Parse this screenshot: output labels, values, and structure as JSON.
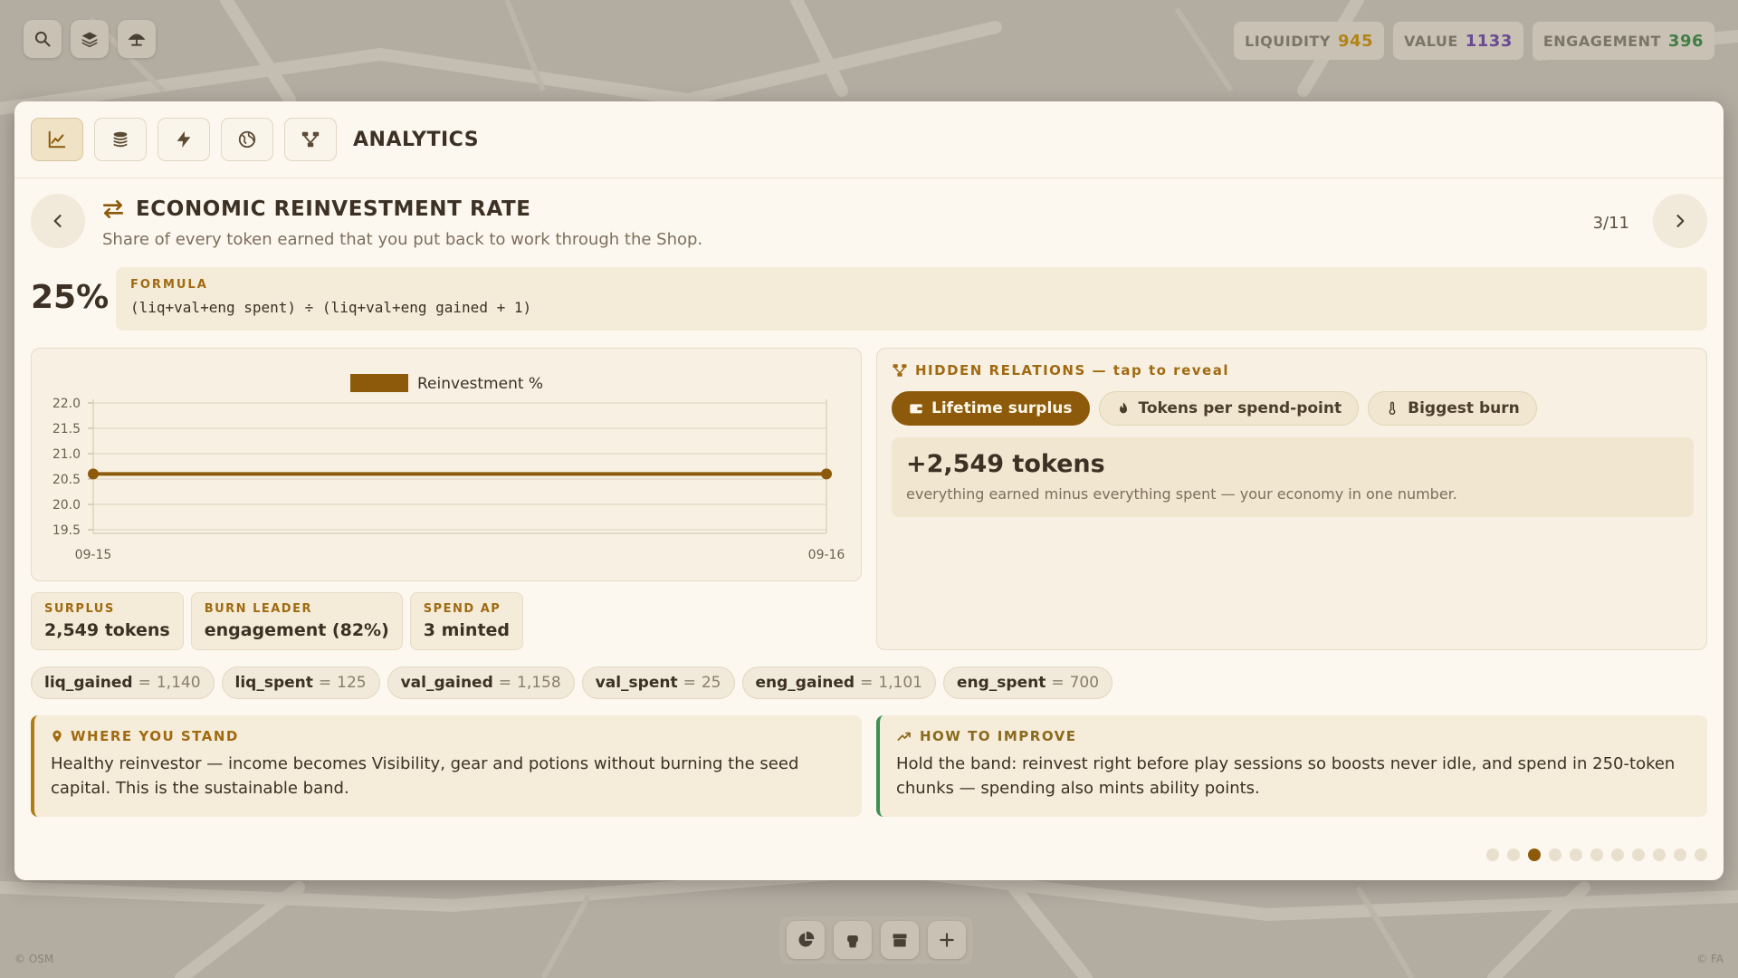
{
  "top_stats": [
    {
      "label": "LIQUIDITY",
      "value": "945",
      "color": "#b08416"
    },
    {
      "label": "VALUE",
      "value": "1133",
      "color": "#6a4a93"
    },
    {
      "label": "ENGAGEMENT",
      "value": "396",
      "color": "#3f7e46"
    }
  ],
  "top_left_buttons": [
    "search-icon",
    "layers-icon",
    "umbrella-icon"
  ],
  "panel": {
    "title": "ANALYTICS",
    "tabs": [
      "chart-line-icon",
      "coins-icon",
      "bolt-icon",
      "globe-icon",
      "network-icon"
    ],
    "active_tab": 0
  },
  "metric": {
    "title": "ECONOMIC REINVESTMENT RATE",
    "subtitle": "Share of every token earned that you put back to work through the Shop.",
    "page": "3/11",
    "value": "25%",
    "formula_label": "FORMULA",
    "formula": "(liq+val+eng spent) ÷ (liq+val+eng gained + 1)"
  },
  "chart_data": {
    "type": "line",
    "title": "",
    "legend": [
      "Reinvestment %"
    ],
    "x": [
      "09-15",
      "09-16"
    ],
    "series": [
      {
        "name": "Reinvestment %",
        "values": [
          20.6,
          20.6
        ],
        "color": "#8c5a0a"
      }
    ],
    "yticks": [
      "22.0",
      "21.5",
      "21.0",
      "20.5",
      "20.0",
      "19.5"
    ],
    "ylim": [
      19.5,
      22.0
    ],
    "grid": true,
    "legend_position": "top-center"
  },
  "relations": {
    "title": "HIDDEN RELATIONS — tap to reveal",
    "tabs": [
      {
        "label": "Lifetime surplus",
        "icon": "wallet-icon",
        "active": true
      },
      {
        "label": "Tokens per spend-point",
        "icon": "flame-icon",
        "active": false
      },
      {
        "label": "Biggest burn",
        "icon": "thermometer-icon",
        "active": false
      }
    ],
    "value": "+2,549 tokens",
    "description": "everything earned minus everything spent — your economy in one number."
  },
  "mini_stats": [
    {
      "label": "SURPLUS",
      "value": "2,549 tokens"
    },
    {
      "label": "BURN LEADER",
      "value": "engagement (82%)"
    },
    {
      "label": "SPEND AP",
      "value": "3 minted"
    }
  ],
  "variables": [
    {
      "key": "liq_gained",
      "value": "1,140"
    },
    {
      "key": "liq_spent",
      "value": "125"
    },
    {
      "key": "val_gained",
      "value": "1,158"
    },
    {
      "key": "val_spent",
      "value": "25"
    },
    {
      "key": "eng_gained",
      "value": "1,101"
    },
    {
      "key": "eng_spent",
      "value": "700"
    }
  ],
  "insights": {
    "stand_title": "WHERE YOU STAND",
    "stand_text": "Healthy reinvestor — income becomes Visibility, gear and potions without burning the seed capital. This is the sustainable band.",
    "improve_title": "HOW TO IMPROVE",
    "improve_text": "Hold the band: reinvest right before play sessions so boosts never idle, and spend in 250-token chunks — spending also mints ability points."
  },
  "pagination": {
    "total": 11,
    "current": 3
  },
  "bottom_bar": [
    "pie-chart-icon",
    "fist-icon",
    "store-icon",
    "plus-icon"
  ],
  "credits": {
    "left": "© OSM",
    "right": "© FA"
  }
}
